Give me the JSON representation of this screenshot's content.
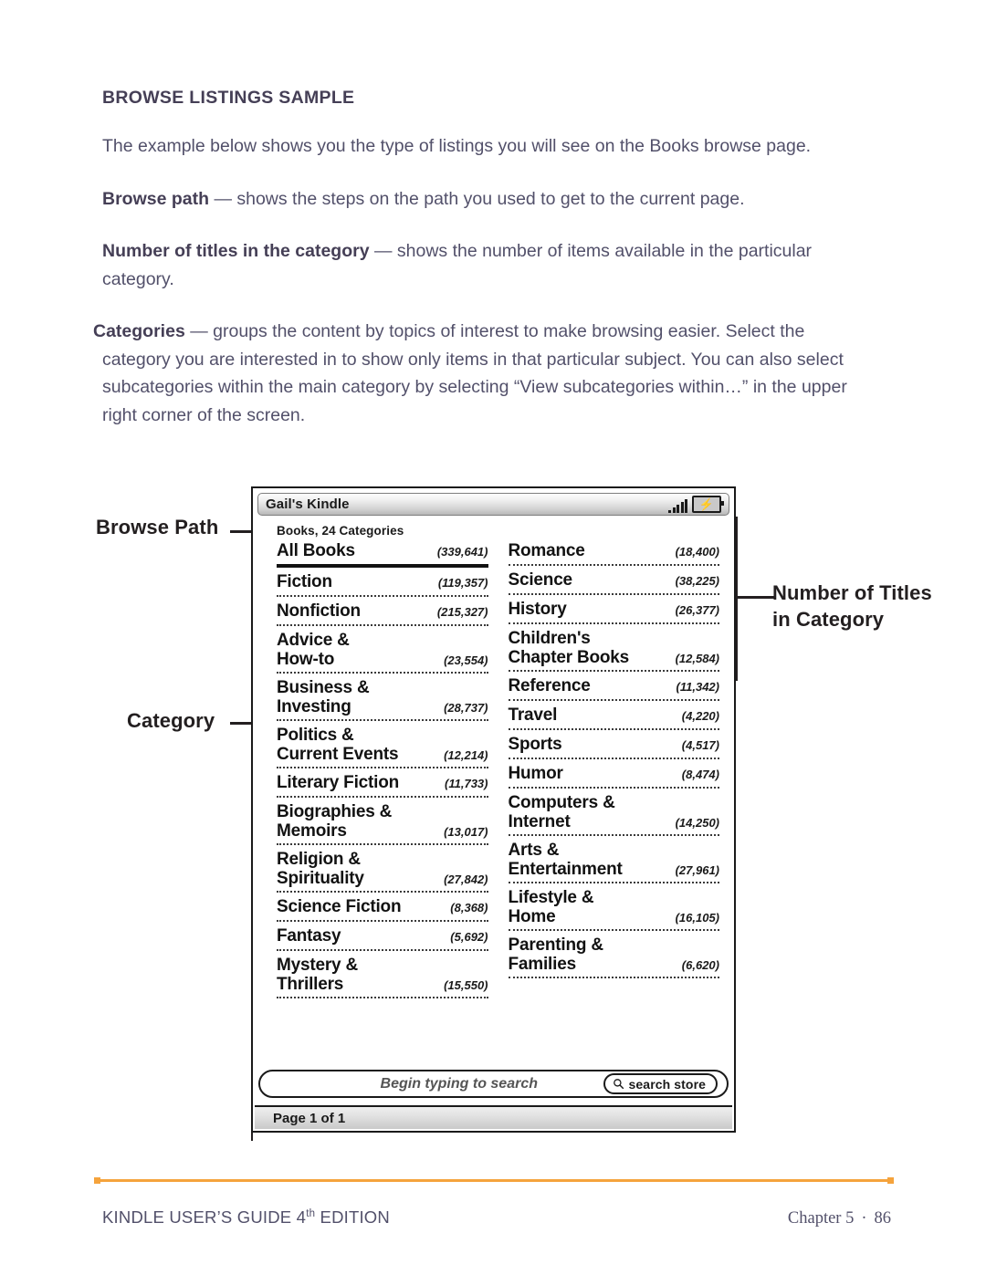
{
  "document": {
    "heading": "BROWSE LISTINGS SAMPLE",
    "paragraphs": [
      {
        "text": "The example below shows you the type of listings you will see on the Books browse page."
      },
      {
        "bold": "Browse path",
        "text": " — shows the steps on the path you used to get to the current page."
      },
      {
        "bold": "Number of titles in the category",
        "text": " — shows the number of items available in the particular category."
      },
      {
        "bold": "Categories",
        "text": " — groups the content by topics of interest to make browsing easier. Select the category you are interested in to show only items in that particular subject. You can also select subcategories within the main category by selecting “View subcategories within…” in the upper right corner of the screen."
      }
    ]
  },
  "annotations": {
    "browse_path": "Browse Path",
    "category": "Category",
    "number_of_titles_line1": "Number of Titles",
    "number_of_titles_line2": "in Category"
  },
  "kindle": {
    "device_title": "Gail's Kindle",
    "status": {
      "signal_icon": "signal-bars-icon",
      "battery_icon": "battery-charging-icon",
      "battery_glyph": "⚡"
    },
    "breadcrumb": "Books, 24 Categories",
    "left_column": [
      {
        "name": "All Books",
        "name2": "",
        "count": "(339,641)",
        "selected": true
      },
      {
        "name": "Fiction",
        "name2": "",
        "count": "(119,357)",
        "selected": false
      },
      {
        "name": "Nonfiction",
        "name2": "",
        "count": "(215,327)",
        "selected": false
      },
      {
        "name": "Advice &",
        "name2": "How-to",
        "count": "(23,554)",
        "selected": false
      },
      {
        "name": "Business &",
        "name2": "Investing",
        "count": "(28,737)",
        "selected": false
      },
      {
        "name": "Politics &",
        "name2": "Current Events",
        "count": "(12,214)",
        "selected": false
      },
      {
        "name": "Literary Fiction",
        "name2": "",
        "count": "(11,733)",
        "selected": false
      },
      {
        "name": "Biographies &",
        "name2": "Memoirs",
        "count": "(13,017)",
        "selected": false
      },
      {
        "name": "Religion &",
        "name2": "Spirituality",
        "count": "(27,842)",
        "selected": false
      },
      {
        "name": "Science Fiction",
        "name2": "",
        "count": "(8,368)",
        "selected": false
      },
      {
        "name": "Fantasy",
        "name2": "",
        "count": "(5,692)",
        "selected": false
      },
      {
        "name": "Mystery &",
        "name2": "Thrillers",
        "count": "(15,550)",
        "selected": false
      }
    ],
    "right_column": [
      {
        "name": "Romance",
        "name2": "",
        "count": "(18,400)",
        "selected": false
      },
      {
        "name": "Science",
        "name2": "",
        "count": "(38,225)",
        "selected": false
      },
      {
        "name": "History",
        "name2": "",
        "count": "(26,377)",
        "selected": false
      },
      {
        "name": "Children's",
        "name2": "Chapter Books",
        "count": "(12,584)",
        "selected": false
      },
      {
        "name": "Reference",
        "name2": "",
        "count": "(11,342)",
        "selected": false
      },
      {
        "name": "Travel",
        "name2": "",
        "count": "(4,220)",
        "selected": false
      },
      {
        "name": "Sports",
        "name2": "",
        "count": "(4,517)",
        "selected": false
      },
      {
        "name": "Humor",
        "name2": "",
        "count": "(8,474)",
        "selected": false
      },
      {
        "name": "Computers &",
        "name2": "Internet",
        "count": "(14,250)",
        "selected": false
      },
      {
        "name": "Arts &",
        "name2": "Entertainment",
        "count": "(27,961)",
        "selected": false
      },
      {
        "name": "Lifestyle &",
        "name2": "Home",
        "count": "(16,105)",
        "selected": false
      },
      {
        "name": "Parenting &",
        "name2": "Families",
        "count": "(6,620)",
        "selected": false
      }
    ],
    "search": {
      "placeholder": "Begin typing to search",
      "value": "",
      "store_button_label": "search store",
      "store_button_icon": "search-icon"
    },
    "page_indicator": "Page 1 of 1"
  },
  "page_footer": {
    "guide_title_before": "KINDLE USER’S GUIDE 4",
    "guide_title_sup": "th",
    "guide_title_after": " EDITION",
    "chapter": "Chapter 5",
    "separator": "·",
    "page_number": "86",
    "rule_color": "#f5a33c"
  }
}
